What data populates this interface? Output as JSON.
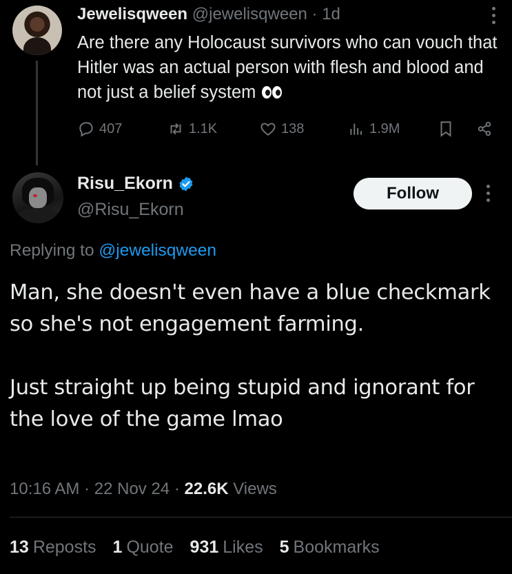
{
  "parent_tweet": {
    "display_name": "Jewelisqween",
    "handle": "@jewelisqween",
    "separator": "·",
    "age": "1d",
    "text": "Are there any Holocaust survivors who can vouch that Hitler was an actual person with flesh and blood and not just a belief system",
    "emoji": "eyes",
    "stats": {
      "replies": "407",
      "reposts": "1.1K",
      "likes": "138",
      "views": "1.9M"
    }
  },
  "main_tweet": {
    "display_name": "Risu_Ekorn",
    "verified": true,
    "handle": "@Risu_Ekorn",
    "follow_label": "Follow",
    "replying_prefix": "Replying to",
    "replying_to": "@jewelisqween",
    "paragraphs": [
      "Man, she doesn't even have a blue checkmark so she's not engagement farming.",
      "Just straight up being stupid and ignorant for the love of the game lmao"
    ],
    "time": "10:16 AM",
    "date": "22 Nov 24",
    "views_count": "22.6K",
    "views_label": "Views",
    "engagement": {
      "reposts_count": "13",
      "reposts_label": "Reposts",
      "quotes_count": "1",
      "quotes_label": "Quote",
      "likes_count": "931",
      "likes_label": "Likes",
      "bookmarks_count": "5",
      "bookmarks_label": "Bookmarks"
    }
  },
  "colors": {
    "background": "#000000",
    "text_primary": "#e7e9ea",
    "text_secondary": "#71767b",
    "link": "#1d9bf0",
    "verified_badge": "#1d9bf0",
    "follow_button_bg": "#eff3f4"
  }
}
